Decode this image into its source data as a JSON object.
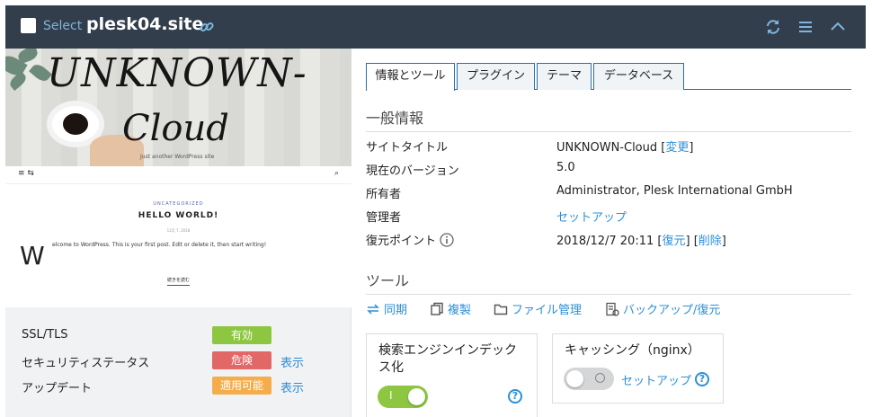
{
  "header": {
    "select_label": "Select",
    "site_name": "plesk04.site",
    "icons": [
      "link-icon",
      "refresh-icon",
      "menu-icon",
      "collapse-chevron-up-icon"
    ]
  },
  "preview": {
    "banner_line1": "UNKNOWN-",
    "banner_line2": "Cloud",
    "tagline": "Just another WordPress site",
    "category": "UNCATEGORIZED",
    "post_title": "HELLO WORLD!",
    "post_date": "12月 7, 2018",
    "dropcap": "W",
    "post_excerpt": "elcome to WordPress. This is your first post. Edit or delete it, then start writing!",
    "read_more": "続きを読む"
  },
  "status": {
    "rows": [
      {
        "label": "SSL/TLS",
        "badge": "有効",
        "badge_color": "#8dc641",
        "link": ""
      },
      {
        "label": "セキュリティステータス",
        "badge": "危険",
        "badge_color": "#e26767",
        "link": "表示"
      },
      {
        "label": "アップデート",
        "badge": "適用可能",
        "badge_color": "#f5ad4c",
        "link": "表示"
      }
    ]
  },
  "tabs": [
    "情報とツール",
    "プラグイン",
    "テーマ",
    "データベース"
  ],
  "general": {
    "heading": "一般情報",
    "site_title_label": "サイトタイトル",
    "site_title_value": "UNKNOWN-Cloud",
    "change_link": "変更",
    "version_label": "現在のバージョン",
    "version_value": "5.0",
    "owner_label": "所有者",
    "owner_value": "Administrator, Plesk International GmbH",
    "admin_label": "管理者",
    "admin_value": "セットアップ",
    "restore_label": "復元ポイント",
    "restore_value": "2018/12/7 20:11",
    "restore_link": "復元",
    "delete_link": "削除"
  },
  "tools": {
    "heading": "ツール",
    "items": [
      "同期",
      "複製",
      "ファイル管理",
      "バックアップ/復元"
    ]
  },
  "cards": {
    "search_index": {
      "title_line1": "検索エンジンインデック",
      "title_line2": "ス化",
      "toggle_on": true
    },
    "caching": {
      "title": "キャッシング（nginx）",
      "setup_link": "セットアップ",
      "toggle_on": false
    }
  },
  "colors": {
    "header_bg": "#323e4b",
    "link": "#2d8fd5",
    "toggle_on": "#8dc641",
    "toggle_off": "#d4d6d8"
  }
}
